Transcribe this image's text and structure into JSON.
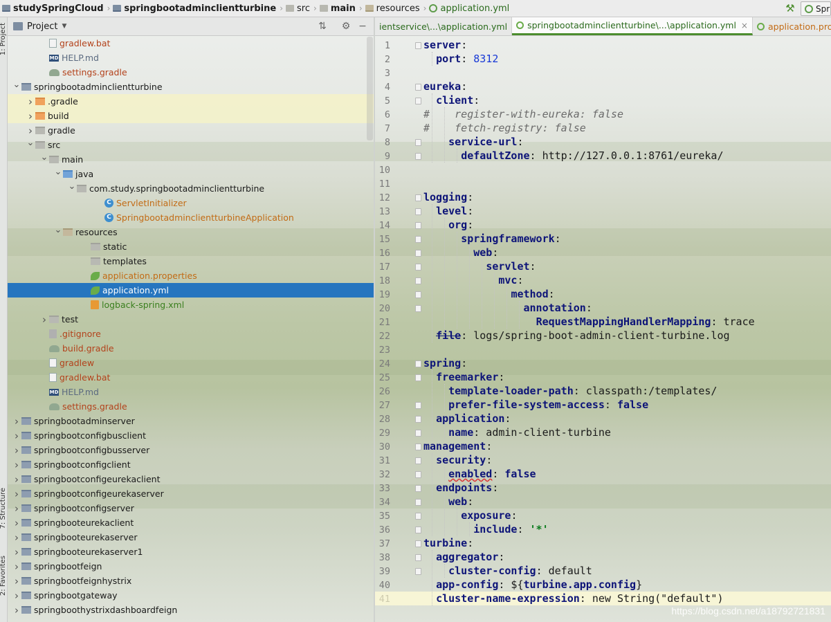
{
  "navbar": {
    "crumbs": [
      "studySpringCloud",
      "springbootadminclientturbine",
      "src",
      "main",
      "resources",
      "application.yml"
    ],
    "run_config": "Spr"
  },
  "left_strip": {
    "project_label": "1: Project",
    "structure_label": "7: Structure",
    "favorites_label": "2: Favorites"
  },
  "project_panel": {
    "title": "Project",
    "tree": [
      {
        "label": "gradlew.bat",
        "icon": "file",
        "color": "red",
        "depth": 3
      },
      {
        "label": "HELP.md",
        "icon": "md",
        "color": "gray",
        "depth": 3
      },
      {
        "label": "settings.gradle",
        "icon": "gradle",
        "color": "red",
        "depth": 3
      },
      {
        "label": "springbootadminclientturbine",
        "icon": "module",
        "color": "",
        "depth": 1,
        "arrow": "open"
      },
      {
        "label": ".gradle",
        "icon": "folder-o",
        "color": "",
        "depth": 2,
        "arrow": "closed",
        "hl": true
      },
      {
        "label": "build",
        "icon": "folder-o",
        "color": "",
        "depth": 2,
        "arrow": "closed",
        "hl": true
      },
      {
        "label": "gradle",
        "icon": "folder",
        "color": "",
        "depth": 2,
        "arrow": "closed"
      },
      {
        "label": "src",
        "icon": "folder",
        "color": "",
        "depth": 2,
        "arrow": "open"
      },
      {
        "label": "main",
        "icon": "folder",
        "color": "",
        "depth": 3,
        "arrow": "open"
      },
      {
        "label": "java",
        "icon": "src",
        "color": "",
        "depth": 4,
        "arrow": "open"
      },
      {
        "label": "com.study.springbootadminclientturbine",
        "icon": "pkg",
        "color": "",
        "depth": 5,
        "arrow": "open"
      },
      {
        "label": "ServletInitializer",
        "icon": "cls",
        "color": "orange",
        "depth": 7
      },
      {
        "label": "SpringbootadminclientturbineApplication",
        "icon": "cls",
        "color": "orange",
        "depth": 7
      },
      {
        "label": "resources",
        "icon": "res",
        "color": "",
        "depth": 4,
        "arrow": "open"
      },
      {
        "label": "static",
        "icon": "folder",
        "color": "",
        "depth": 6
      },
      {
        "label": "templates",
        "icon": "folder",
        "color": "",
        "depth": 6
      },
      {
        "label": "application.properties",
        "icon": "leaf",
        "color": "orange",
        "depth": 6
      },
      {
        "label": "application.yml",
        "icon": "leaf",
        "color": "",
        "depth": 6,
        "selected": true
      },
      {
        "label": "logback-spring.xml",
        "icon": "xml",
        "color": "green",
        "depth": 6
      },
      {
        "label": "test",
        "icon": "folder",
        "color": "",
        "depth": 3,
        "arrow": "closed"
      },
      {
        "label": ".gitignore",
        "icon": "dots",
        "color": "red",
        "depth": 3
      },
      {
        "label": "build.gradle",
        "icon": "gradle",
        "color": "red",
        "depth": 3
      },
      {
        "label": "gradlew",
        "icon": "file",
        "color": "red",
        "depth": 3
      },
      {
        "label": "gradlew.bat",
        "icon": "file",
        "color": "red",
        "depth": 3
      },
      {
        "label": "HELP.md",
        "icon": "md",
        "color": "gray",
        "depth": 3
      },
      {
        "label": "settings.gradle",
        "icon": "gradle",
        "color": "red",
        "depth": 3
      },
      {
        "label": "springbootadminserver",
        "icon": "module",
        "color": "",
        "depth": 1,
        "arrow": "closed"
      },
      {
        "label": "springbootconfigbusclient",
        "icon": "module",
        "color": "",
        "depth": 1,
        "arrow": "closed"
      },
      {
        "label": "springbootconfigbusserver",
        "icon": "module",
        "color": "",
        "depth": 1,
        "arrow": "closed"
      },
      {
        "label": "springbootconfigclient",
        "icon": "module",
        "color": "",
        "depth": 1,
        "arrow": "closed"
      },
      {
        "label": "springbootconfigeurekaclient",
        "icon": "module",
        "color": "",
        "depth": 1,
        "arrow": "closed"
      },
      {
        "label": "springbootconfigeurekaserver",
        "icon": "module",
        "color": "",
        "depth": 1,
        "arrow": "closed"
      },
      {
        "label": "springbootconfigserver",
        "icon": "module",
        "color": "",
        "depth": 1,
        "arrow": "closed"
      },
      {
        "label": "springbooteurekaclient",
        "icon": "module",
        "color": "",
        "depth": 1,
        "arrow": "closed"
      },
      {
        "label": "springbooteurekaserver",
        "icon": "module",
        "color": "",
        "depth": 1,
        "arrow": "closed"
      },
      {
        "label": "springbooteurekaserver1",
        "icon": "module",
        "color": "",
        "depth": 1,
        "arrow": "closed"
      },
      {
        "label": "springbootfeign",
        "icon": "module",
        "color": "",
        "depth": 1,
        "arrow": "closed"
      },
      {
        "label": "springbootfeignhystrix",
        "icon": "module",
        "color": "",
        "depth": 1,
        "arrow": "closed"
      },
      {
        "label": "springbootgateway",
        "icon": "module",
        "color": "",
        "depth": 1,
        "arrow": "closed"
      },
      {
        "label": "springboothystrixdashboardfeign",
        "icon": "module",
        "color": "",
        "depth": 1,
        "arrow": "closed"
      }
    ]
  },
  "editor": {
    "tabs": [
      {
        "label": "ientservice\\...\\application.yml",
        "active": false,
        "color": "green"
      },
      {
        "label": "springbootadminclientturbine\\...\\application.yml",
        "active": true,
        "color": "green"
      },
      {
        "label": "application.propertie",
        "active": false,
        "color": "orange"
      }
    ],
    "current_line": 41,
    "lines": [
      [
        [
          "k",
          "server"
        ],
        [
          "v",
          ":"
        ]
      ],
      [
        [
          "v",
          "  "
        ],
        [
          "k",
          "port"
        ],
        [
          "v",
          ": "
        ],
        [
          "n",
          "8312"
        ]
      ],
      [],
      [
        [
          "k",
          "eureka"
        ],
        [
          "v",
          ":"
        ]
      ],
      [
        [
          "v",
          "  "
        ],
        [
          "k",
          "client"
        ],
        [
          "v",
          ":"
        ]
      ],
      [
        [
          "c",
          "#    register-with-eureka: false"
        ]
      ],
      [
        [
          "c",
          "#    fetch-registry: false"
        ]
      ],
      [
        [
          "v",
          "    "
        ],
        [
          "k",
          "service-url"
        ],
        [
          "v",
          ":"
        ]
      ],
      [
        [
          "v",
          "      "
        ],
        [
          "k",
          "defaultZone"
        ],
        [
          "v",
          ": http://127.0.0.1:8761/eureka/"
        ]
      ],
      [],
      [],
      [
        [
          "k",
          "logging"
        ],
        [
          "v",
          ":"
        ]
      ],
      [
        [
          "v",
          "  "
        ],
        [
          "k",
          "level"
        ],
        [
          "v",
          ":"
        ]
      ],
      [
        [
          "v",
          "    "
        ],
        [
          "k",
          "org"
        ],
        [
          "v",
          ":"
        ]
      ],
      [
        [
          "v",
          "      "
        ],
        [
          "k",
          "springframework"
        ],
        [
          "v",
          ":"
        ]
      ],
      [
        [
          "v",
          "        "
        ],
        [
          "k",
          "web"
        ],
        [
          "v",
          ":"
        ]
      ],
      [
        [
          "v",
          "          "
        ],
        [
          "k",
          "servlet"
        ],
        [
          "v",
          ":"
        ]
      ],
      [
        [
          "v",
          "            "
        ],
        [
          "k",
          "mvc"
        ],
        [
          "v",
          ":"
        ]
      ],
      [
        [
          "v",
          "              "
        ],
        [
          "k",
          "method"
        ],
        [
          "v",
          ":"
        ]
      ],
      [
        [
          "v",
          "                "
        ],
        [
          "k",
          "annotation"
        ],
        [
          "v",
          ":"
        ]
      ],
      [
        [
          "v",
          "                  "
        ],
        [
          "k",
          "RequestMappingHandlerMapping"
        ],
        [
          "v",
          ": trace"
        ]
      ],
      [
        [
          "v",
          "  "
        ],
        [
          "ks",
          "file"
        ],
        [
          "v",
          ": logs/spring-boot-admin-client-turbine.log"
        ]
      ],
      [],
      [
        [
          "k",
          "spring"
        ],
        [
          "v",
          ":"
        ]
      ],
      [
        [
          "v",
          "  "
        ],
        [
          "k",
          "freemarker"
        ],
        [
          "v",
          ":"
        ]
      ],
      [
        [
          "v",
          "    "
        ],
        [
          "k",
          "template-loader-path"
        ],
        [
          "v",
          ": classpath:/templates/"
        ]
      ],
      [
        [
          "v",
          "    "
        ],
        [
          "k",
          "prefer-file-system-access"
        ],
        [
          "v",
          ": "
        ],
        [
          "k",
          "false"
        ]
      ],
      [
        [
          "v",
          "  "
        ],
        [
          "k",
          "application"
        ],
        [
          "v",
          ":"
        ]
      ],
      [
        [
          "v",
          "    "
        ],
        [
          "k",
          "name"
        ],
        [
          "v",
          ": admin-client-turbine"
        ]
      ],
      [
        [
          "k",
          "management"
        ],
        [
          "v",
          ":"
        ]
      ],
      [
        [
          "v",
          "  "
        ],
        [
          "k",
          "security"
        ],
        [
          "v",
          ":"
        ]
      ],
      [
        [
          "v",
          "    "
        ],
        [
          "kw",
          "enabled"
        ],
        [
          "v",
          ": "
        ],
        [
          "k",
          "false"
        ]
      ],
      [
        [
          "v",
          "  "
        ],
        [
          "k",
          "endpoints"
        ],
        [
          "v",
          ":"
        ]
      ],
      [
        [
          "v",
          "    "
        ],
        [
          "k",
          "web"
        ],
        [
          "v",
          ":"
        ]
      ],
      [
        [
          "v",
          "      "
        ],
        [
          "k",
          "exposure"
        ],
        [
          "v",
          ":"
        ]
      ],
      [
        [
          "v",
          "        "
        ],
        [
          "k",
          "include"
        ],
        [
          "v",
          ": "
        ],
        [
          "s",
          "'*'"
        ]
      ],
      [
        [
          "k",
          "turbine"
        ],
        [
          "v",
          ":"
        ]
      ],
      [
        [
          "v",
          "  "
        ],
        [
          "k",
          "aggregator"
        ],
        [
          "v",
          ":"
        ]
      ],
      [
        [
          "v",
          "    "
        ],
        [
          "k",
          "cluster-config"
        ],
        [
          "v",
          ": default"
        ]
      ],
      [
        [
          "v",
          "  "
        ],
        [
          "k",
          "app-config"
        ],
        [
          "v",
          ": ${"
        ],
        [
          "k",
          "turbine.app.config"
        ],
        [
          "v",
          "}"
        ]
      ],
      [
        [
          "v",
          "  "
        ],
        [
          "k",
          "cluster-name-expression"
        ],
        [
          "v",
          ": new String(\"default\")"
        ]
      ]
    ]
  },
  "watermark": "https://blog.csdn.net/a18792721831"
}
